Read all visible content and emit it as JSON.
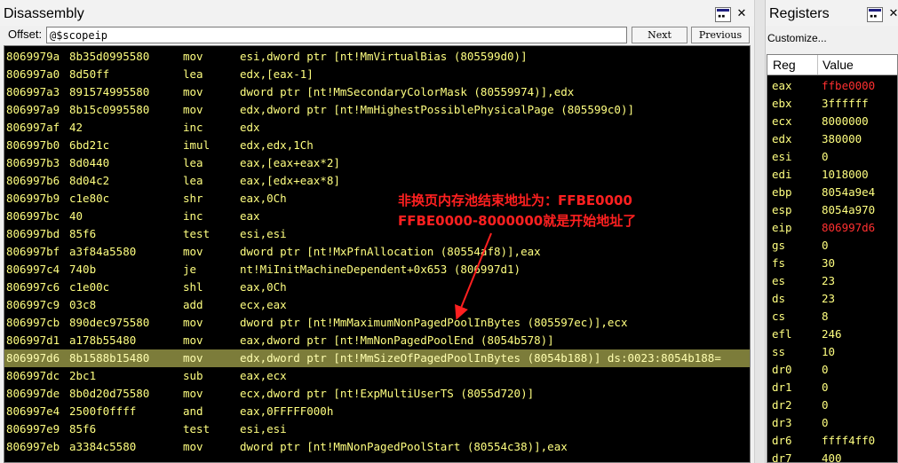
{
  "disassembly": {
    "title": "Disassembly",
    "offset_label": "Offset:",
    "offset_value": "@$scopeip",
    "next_label": "Next",
    "prev_label": "Previous",
    "lines": [
      {
        "addr": "8069979a",
        "bytes": "8b35d0995580",
        "mnemonic": "mov",
        "operands": "esi,dword ptr [nt!MmVirtualBias (805599d0)]"
      },
      {
        "addr": "806997a0",
        "bytes": "8d50ff",
        "mnemonic": "lea",
        "operands": "edx,[eax-1]"
      },
      {
        "addr": "806997a3",
        "bytes": "891574995580",
        "mnemonic": "mov",
        "operands": "dword ptr [nt!MmSecondaryColorMask (80559974)],edx"
      },
      {
        "addr": "806997a9",
        "bytes": "8b15c0995580",
        "mnemonic": "mov",
        "operands": "edx,dword ptr [nt!MmHighestPossiblePhysicalPage (805599c0)]"
      },
      {
        "addr": "806997af",
        "bytes": "42",
        "mnemonic": "inc",
        "operands": "edx"
      },
      {
        "addr": "806997b0",
        "bytes": "6bd21c",
        "mnemonic": "imul",
        "operands": "edx,edx,1Ch"
      },
      {
        "addr": "806997b3",
        "bytes": "8d0440",
        "mnemonic": "lea",
        "operands": "eax,[eax+eax*2]"
      },
      {
        "addr": "806997b6",
        "bytes": "8d04c2",
        "mnemonic": "lea",
        "operands": "eax,[edx+eax*8]"
      },
      {
        "addr": "806997b9",
        "bytes": "c1e80c",
        "mnemonic": "shr",
        "operands": "eax,0Ch"
      },
      {
        "addr": "806997bc",
        "bytes": "40",
        "mnemonic": "inc",
        "operands": "eax"
      },
      {
        "addr": "806997bd",
        "bytes": "85f6",
        "mnemonic": "test",
        "operands": "esi,esi"
      },
      {
        "addr": "806997bf",
        "bytes": "a3f84a5580",
        "mnemonic": "mov",
        "operands": "dword ptr [nt!MxPfnAllocation (80554af8)],eax"
      },
      {
        "addr": "806997c4",
        "bytes": "740b",
        "mnemonic": "je",
        "operands": "nt!MiInitMachineDependent+0x653 (806997d1)"
      },
      {
        "addr": "806997c6",
        "bytes": "c1e00c",
        "mnemonic": "shl",
        "operands": "eax,0Ch"
      },
      {
        "addr": "806997c9",
        "bytes": "03c8",
        "mnemonic": "add",
        "operands": "ecx,eax"
      },
      {
        "addr": "806997cb",
        "bytes": "890dec975580",
        "mnemonic": "mov",
        "operands": "dword ptr [nt!MmMaximumNonPagedPoolInBytes (805597ec)],ecx"
      },
      {
        "addr": "806997d1",
        "bytes": "a178b55480",
        "mnemonic": "mov",
        "operands": "eax,dword ptr [nt!MmNonPagedPoolEnd (8054b578)]"
      },
      {
        "addr": "806997d6",
        "bytes": "8b1588b15480",
        "mnemonic": "mov",
        "operands": "edx,dword ptr [nt!MmSizeOfPagedPoolInBytes (8054b188)] ds:0023:8054b188=",
        "highlight": true
      },
      {
        "addr": "806997dc",
        "bytes": "2bc1",
        "mnemonic": "sub",
        "operands": "eax,ecx"
      },
      {
        "addr": "806997de",
        "bytes": "8b0d20d75580",
        "mnemonic": "mov",
        "operands": "ecx,dword ptr [nt!ExpMultiUserTS (8055d720)]"
      },
      {
        "addr": "806997e4",
        "bytes": "2500f0ffff",
        "mnemonic": "and",
        "operands": "eax,0FFFFF000h"
      },
      {
        "addr": "806997e9",
        "bytes": "85f6",
        "mnemonic": "test",
        "operands": "esi,esi"
      },
      {
        "addr": "806997eb",
        "bytes": "a3384c5580",
        "mnemonic": "mov",
        "operands": "dword ptr [nt!MmNonPagedPoolStart (80554c38)],eax"
      }
    ],
    "annotation": {
      "line1": "非换页内存池结束地址为：FFBE0000",
      "line2": "FFBE0000-8000000就是开始地址了"
    }
  },
  "registers": {
    "title": "Registers",
    "customize_label": "Customize...",
    "col_reg": "Reg",
    "col_value": "Value",
    "rows": [
      {
        "name": "eax",
        "value": "ffbe0000",
        "changed": true
      },
      {
        "name": "ebx",
        "value": "3ffffff"
      },
      {
        "name": "ecx",
        "value": "8000000"
      },
      {
        "name": "edx",
        "value": "380000"
      },
      {
        "name": "esi",
        "value": "0"
      },
      {
        "name": "edi",
        "value": "1018000"
      },
      {
        "name": "ebp",
        "value": "8054a9e4"
      },
      {
        "name": "esp",
        "value": "8054a970"
      },
      {
        "name": "eip",
        "value": "806997d6",
        "changed": true
      },
      {
        "name": "gs",
        "value": "0"
      },
      {
        "name": "fs",
        "value": "30"
      },
      {
        "name": "es",
        "value": "23"
      },
      {
        "name": "ds",
        "value": "23"
      },
      {
        "name": "cs",
        "value": "8"
      },
      {
        "name": "efl",
        "value": "246"
      },
      {
        "name": "ss",
        "value": "10"
      },
      {
        "name": "dr0",
        "value": "0"
      },
      {
        "name": "dr1",
        "value": "0"
      },
      {
        "name": "dr2",
        "value": "0"
      },
      {
        "name": "dr3",
        "value": "0"
      },
      {
        "name": "dr6",
        "value": "ffff4ff0"
      },
      {
        "name": "dr7",
        "value": "400"
      }
    ]
  },
  "icons": {
    "window_icon": "window-menu-icon",
    "close_icon": "close-icon"
  },
  "colors": {
    "code_text": "#ffff80",
    "highlight_bg": "#7c7c3a",
    "changed_value": "#ff3030",
    "annotation": "#ff2020"
  }
}
